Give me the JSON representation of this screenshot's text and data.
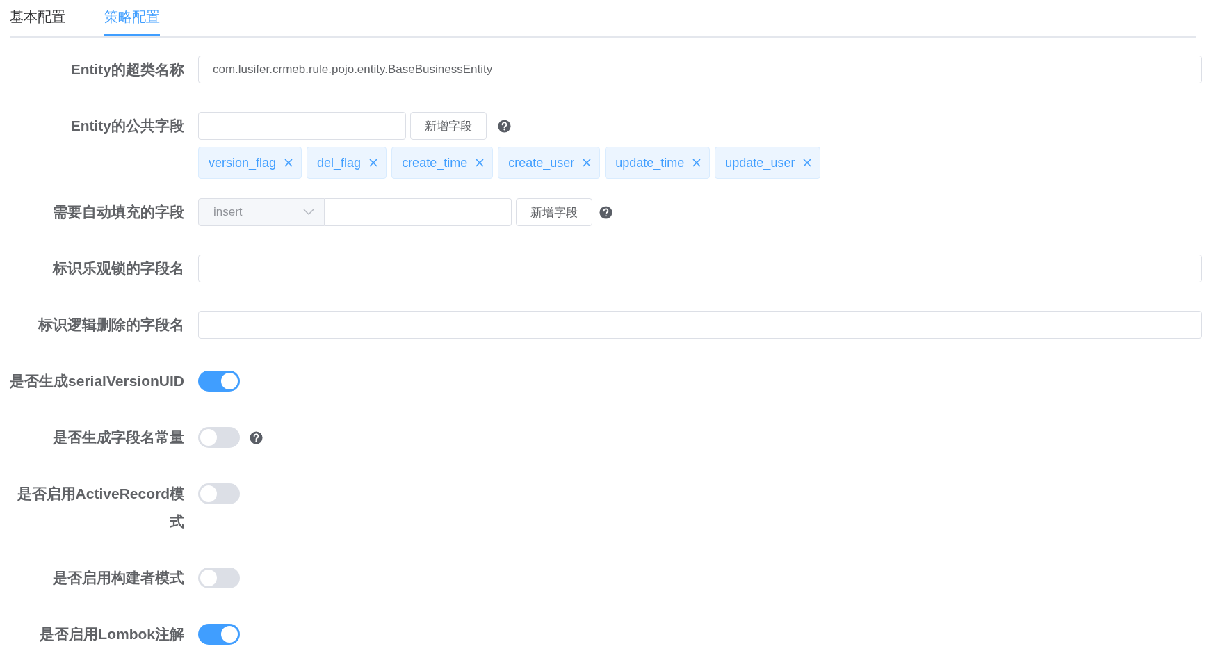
{
  "tabs": [
    {
      "label": "基本配置",
      "selected": false
    },
    {
      "label": "策略配置",
      "selected": true
    }
  ],
  "form": [
    {
      "kind": "text",
      "label": "Entity的超类名称",
      "value": "com.lusifer.crmeb.rule.pojo.entity.BaseBusinessEntity"
    },
    {
      "kind": "tags",
      "label": "Entity的公共字段",
      "button": "新增字段",
      "help": true,
      "tags": [
        "version_flag",
        "del_flag",
        "create_time",
        "create_user",
        "update_time",
        "update_user"
      ]
    },
    {
      "kind": "select",
      "label": "需要自动填充的字段",
      "select": "insert",
      "button": "新增字段",
      "help": true
    },
    {
      "kind": "text",
      "label": "标识乐观锁的字段名"
    },
    {
      "kind": "text",
      "label": "标识逻辑删除的字段名"
    },
    {
      "kind": "switch",
      "label": "是否生成serialVersionUID",
      "on": true,
      "help": false
    },
    {
      "kind": "switch",
      "label": "是否生成字段名常量",
      "on": false,
      "help": true
    },
    {
      "kind": "switch",
      "label": "是否启用ActiveRecord模式",
      "on": false,
      "help": false
    },
    {
      "kind": "switch",
      "label": "是否启用构建者模式",
      "on": false,
      "help": false
    },
    {
      "kind": "switch",
      "label": "是否启用Lombok注解",
      "on": true,
      "help": false
    }
  ]
}
